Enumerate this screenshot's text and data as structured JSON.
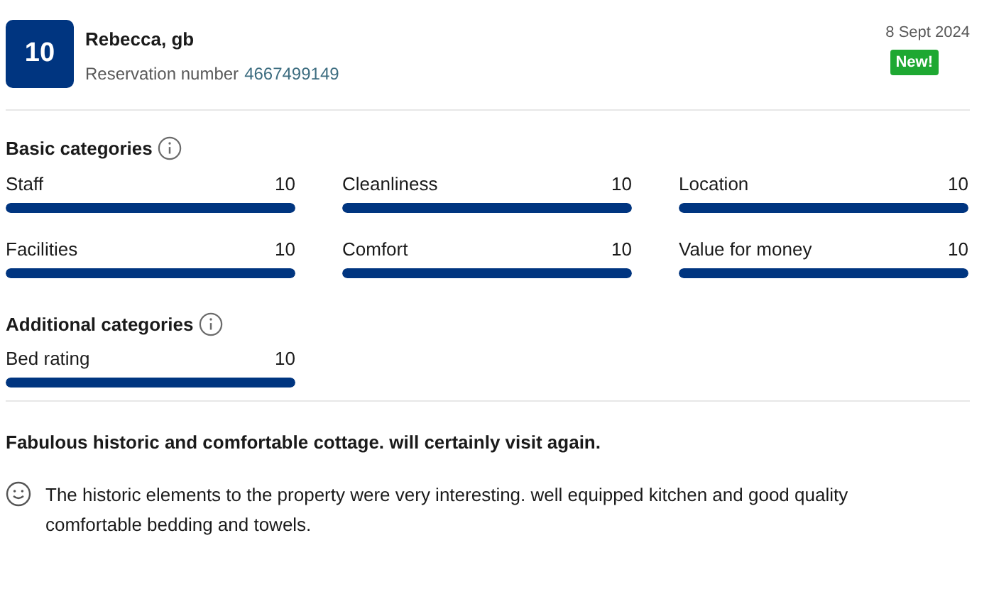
{
  "review": {
    "score": "10",
    "name": "Rebecca, gb",
    "reservation_label": "Reservation number",
    "reservation_number": "4667499149",
    "date": "8 Sept 2024",
    "badge": "New!"
  },
  "basic_categories": {
    "title": "Basic categories",
    "items": [
      {
        "label": "Staff",
        "value": "10",
        "level": 1
      },
      {
        "label": "Cleanliness",
        "value": "10",
        "level": 1
      },
      {
        "label": "Location",
        "value": "10",
        "level": 1
      },
      {
        "label": "Facilities",
        "value": "10",
        "level": 1
      },
      {
        "label": "Comfort",
        "value": "10",
        "level": 1
      },
      {
        "label": "Value for money",
        "value": "10",
        "level": 1
      }
    ]
  },
  "additional_categories": {
    "title": "Additional categories",
    "items": [
      {
        "label": "Bed rating",
        "value": "10",
        "level": 1
      }
    ]
  },
  "headline": "Fabulous historic and comfortable cottage. will certainly visit again.",
  "comments": [
    {
      "kind": "positive",
      "text": "The historic elements to the property were very interesting. well equipped kitchen and good quality comfortable bedding and towels."
    }
  ]
}
